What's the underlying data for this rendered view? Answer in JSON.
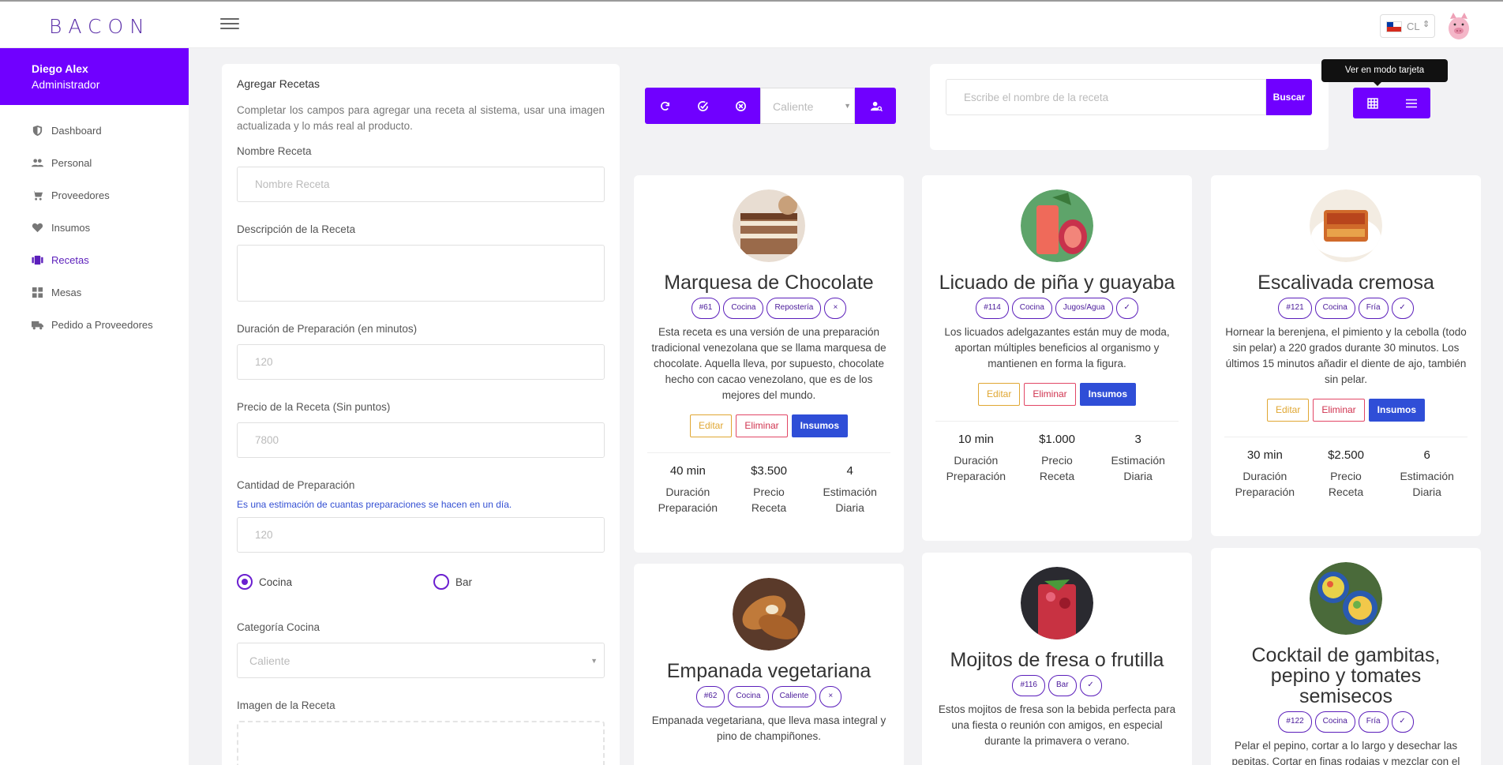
{
  "app": {
    "logo": "BACON",
    "lang_code": "CL"
  },
  "user": {
    "name": "Diego Alex",
    "role": "Administrador"
  },
  "nav": [
    {
      "label": "Dashboard",
      "icon": "shield-icon"
    },
    {
      "label": "Personal",
      "icon": "people-icon"
    },
    {
      "label": "Proveedores",
      "icon": "cart-icon"
    },
    {
      "label": "Insumos",
      "icon": "heart-icon"
    },
    {
      "label": "Recetas",
      "icon": "recipes-icon",
      "active": true
    },
    {
      "label": "Mesas",
      "icon": "grid-icon"
    },
    {
      "label": "Pedido a Proveedores",
      "icon": "truck-icon"
    }
  ],
  "form": {
    "title": "Agregar Recetas",
    "description": "Completar los campos para agregar una receta al sistema, usar una imagen actualizada y lo más real al producto.",
    "name_label": "Nombre Receta",
    "name_placeholder": "Nombre Receta",
    "desc_label": "Descripción de la Receta",
    "duration_label": "Duración de Preparación (en minutos)",
    "duration_placeholder": "120",
    "price_label": "Precio de la Receta (Sin puntos)",
    "price_placeholder": "7800",
    "qty_label": "Cantidad de Preparación",
    "qty_hint": "Es una estimación de cuantas preparaciones se hacen en un día.",
    "qty_placeholder": "120",
    "radio_cocina": "Cocina",
    "radio_bar": "Bar",
    "category_label": "Categoría Cocina",
    "category_value": "Caliente",
    "image_label": "Imagen de la Receta"
  },
  "toolbar": {
    "filter_value": "Caliente"
  },
  "search": {
    "placeholder": "Escribe el nombre de la receta",
    "button": "Buscar"
  },
  "view": {
    "tooltip": "Ver en modo tarjeta"
  },
  "buttons": {
    "edit": "Editar",
    "delete": "Eliminar",
    "supplies": "Insumos"
  },
  "stat_labels": {
    "duration": [
      "Duración",
      "Preparación"
    ],
    "price": [
      "Precio",
      "Receta"
    ],
    "estimate": [
      "Estimación",
      "Diaria"
    ]
  },
  "cards": [
    {
      "title": "Marquesa de Chocolate",
      "tags": [
        "#61",
        "Cocina",
        "Repostería"
      ],
      "status": "×",
      "desc": "Esta receta es una versión de una preparación tradicional venezolana que se llama marquesa de chocolate. Aquella lleva, por supuesto, chocolate hecho con cacao venezolano, que es de los mejores del mundo.",
      "duration": "40 min",
      "price": "$3.500",
      "estimate": "4"
    },
    {
      "title": "Licuado de piña y guayaba",
      "tags": [
        "#114",
        "Cocina",
        "Jugos/Agua"
      ],
      "status": "✓",
      "desc": "Los licuados adelgazantes están muy de moda, aportan múltiples beneficios al organismo y mantienen en forma la figura.",
      "duration": "10 min",
      "price": "$1.000",
      "estimate": "3"
    },
    {
      "title": "Escalivada cremosa",
      "tags": [
        "#121",
        "Cocina",
        "Fría"
      ],
      "status": "✓",
      "desc": "Hornear la berenjena, el pimiento y la cebolla (todo sin pelar) a 220 grados durante 30 minutos. Los últimos 15 minutos añadir el diente de ajo, también sin pelar.",
      "duration": "30 min",
      "price": "$2.500",
      "estimate": "6"
    },
    {
      "title": "Empanada vegetariana",
      "tags": [
        "#62",
        "Cocina",
        "Caliente"
      ],
      "status": "×",
      "desc": "Empanada vegetariana, que lleva masa integral y pino de champiñones."
    },
    {
      "title": "Mojitos de fresa o frutilla",
      "tags": [
        "#116",
        "Bar"
      ],
      "status": "✓",
      "desc": "Estos mojitos de fresa son la bebida perfecta para una fiesta o reunión con amigos, en especial durante la primavera o verano."
    },
    {
      "title": "Cocktail de gambitas, pepino y tomates semisecos",
      "tags": [
        "#122",
        "Cocina",
        "Fría"
      ],
      "status": "✓",
      "desc": "Pelar el pepino, cortar a lo largo y desechar las pepitas. Cortar en finas rodajas y mezclar con el"
    }
  ]
}
